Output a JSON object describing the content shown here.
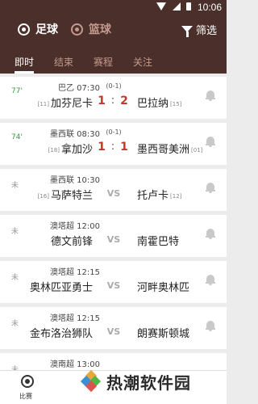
{
  "statusbar": {
    "time": "10:06"
  },
  "sport_tabs": [
    {
      "label": "足球",
      "icon": "soccer-ball-icon",
      "active": true
    },
    {
      "label": "篮球",
      "icon": "basketball-icon",
      "active": false
    }
  ],
  "filter_label": "筛选",
  "tabs": [
    "即时",
    "结束",
    "赛程",
    "关注"
  ],
  "matches": [
    {
      "status": "77'",
      "live": true,
      "league": "巴乙 07:30",
      "half": "(0-1)",
      "home": "加芬尼卡",
      "home_rank": "[11]",
      "away": "巴拉纳",
      "away_rank": "[15]",
      "home_score": "1",
      "away_score": "2",
      "sep": ":"
    },
    {
      "status": "74'",
      "live": true,
      "league": "墨西联 08:30",
      "half": "(0-1)",
      "home": "拿加沙",
      "home_rank": "[18]",
      "away": "墨西哥美洲",
      "away_rank": "[01]",
      "home_score": "1",
      "away_score": "1",
      "sep": ":"
    },
    {
      "status": "未",
      "live": false,
      "league": "墨西联 10:30",
      "half": "",
      "home": "马萨特兰",
      "home_rank": "[16]",
      "away": "托卢卡",
      "away_rank": "[12]",
      "vs": "VS"
    },
    {
      "status": "未",
      "live": false,
      "league": "澳塔超 12:00",
      "half": "",
      "home": "德文前锋",
      "home_rank": "",
      "away": "南霍巴特",
      "away_rank": "",
      "vs": "VS"
    },
    {
      "status": "未",
      "live": false,
      "league": "澳塔超 12:15",
      "half": "",
      "home": "奥林匹亚勇士",
      "home_rank": "",
      "away": "河畔奥林匹",
      "away_rank": "",
      "vs": "VS"
    },
    {
      "status": "未",
      "live": false,
      "league": "澳塔超 12:15",
      "half": "",
      "home": "金布洛治狮队",
      "home_rank": "",
      "away": "朗赛斯顿城",
      "away_rank": "",
      "vs": "VS"
    },
    {
      "status": "未",
      "live": false,
      "league": "澳南超 13:00",
      "half": "",
      "home": "",
      "home_rank": "",
      "away": "",
      "away_rank": ""
    }
  ],
  "bottom_nav": {
    "label": "比赛",
    "icon": "soccer-ball-icon"
  },
  "watermark": "热潮软件园",
  "colors": {
    "header": "#4a2f2a",
    "live_status": "#2f9e46",
    "score": "#c0392b"
  }
}
